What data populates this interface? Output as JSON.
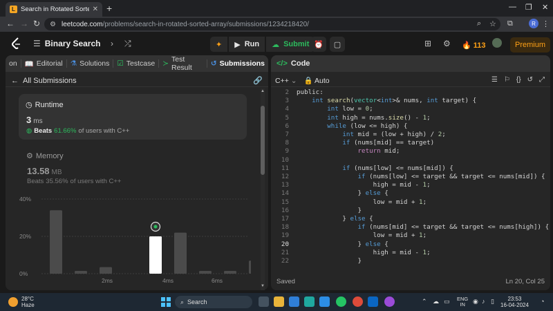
{
  "browser": {
    "tab_title": "Search in Rotated Sorted Array - L",
    "url_host": "leetcode.com",
    "url_path": "/problems/search-in-rotated-sorted-array/submissions/1234218420/",
    "profile_initial": "R"
  },
  "header": {
    "problem_list": "Binary Search",
    "run_label": "Run",
    "submit_label": "Submit",
    "streak_count": "113",
    "premium_label": "Premium"
  },
  "left_tabs": [
    {
      "label": "on"
    },
    {
      "label": "Editorial"
    },
    {
      "label": "Solutions"
    },
    {
      "label": "Testcase"
    },
    {
      "label": "Test Result"
    },
    {
      "label": "Submissions"
    }
  ],
  "submissions": {
    "back_label": "All Submissions",
    "runtime": {
      "title": "Runtime",
      "value": "3",
      "unit": "ms",
      "beats_prefix": "Beats",
      "beats_pct": "61.66%",
      "beats_suffix": "of users with C++"
    },
    "memory": {
      "title": "Memory",
      "value": "13.58",
      "unit": "MB",
      "beats_prefix": "Beats",
      "beats_pct": "35.56%",
      "beats_suffix": "of users with C++"
    }
  },
  "chart_data": {
    "type": "bar",
    "y_ticks": [
      "40%",
      "20%",
      "0%"
    ],
    "x_ticks": [
      "2ms",
      "4ms",
      "6ms"
    ],
    "ylim": [
      0,
      40
    ],
    "values": [
      34,
      1.5,
      3.5,
      0,
      20,
      22,
      1.5,
      1.5,
      7
    ],
    "highlight_index": 4
  },
  "code_panel": {
    "title": "Code",
    "language": "C++",
    "auto_label": "Auto",
    "status": "Saved",
    "cursor": "Ln 20, Col 25",
    "current_line": 20,
    "lines": [
      {
        "no": "2",
        "text": "public:"
      },
      {
        "no": "3",
        "text": "    int search(vector<int>& nums, int target) {"
      },
      {
        "no": "4",
        "text": "        int low = 0;"
      },
      {
        "no": "5",
        "text": "        int high = nums.size() - 1;"
      },
      {
        "no": "6",
        "text": "        while (low <= high) {"
      },
      {
        "no": "7",
        "text": "            int mid = (low + high) / 2;"
      },
      {
        "no": "8",
        "text": "            if (nums[mid] == target)"
      },
      {
        "no": "9",
        "text": "                return mid;"
      },
      {
        "no": "10",
        "text": ""
      },
      {
        "no": "11",
        "text": "            if (nums[low] <= nums[mid]) {"
      },
      {
        "no": "12",
        "text": "                if (nums[low] <= target && target <= nums[mid]) {"
      },
      {
        "no": "13",
        "text": "                    high = mid - 1;"
      },
      {
        "no": "14",
        "text": "                } else {"
      },
      {
        "no": "15",
        "text": "                    low = mid + 1;"
      },
      {
        "no": "16",
        "text": "                }"
      },
      {
        "no": "17",
        "text": "            } else {"
      },
      {
        "no": "18",
        "text": "                if (nums[mid] <= target && target <= nums[high]) {"
      },
      {
        "no": "19",
        "text": "                    low = mid + 1;"
      },
      {
        "no": "20",
        "text": "                } else {"
      },
      {
        "no": "21",
        "text": "                    high = mid - 1;"
      },
      {
        "no": "22",
        "text": "                }"
      }
    ]
  },
  "taskbar": {
    "temp": "28°C",
    "weather": "Haze",
    "search_label": "Search",
    "lang": "ENG",
    "region": "IN",
    "time": "23:53",
    "date": "16-04-2024"
  },
  "colors": {
    "accent_green": "#2cbb5d",
    "accent_orange": "#ffa116",
    "bar_gray": "#4b4b4b",
    "bar_highlight": "#ffffff"
  }
}
